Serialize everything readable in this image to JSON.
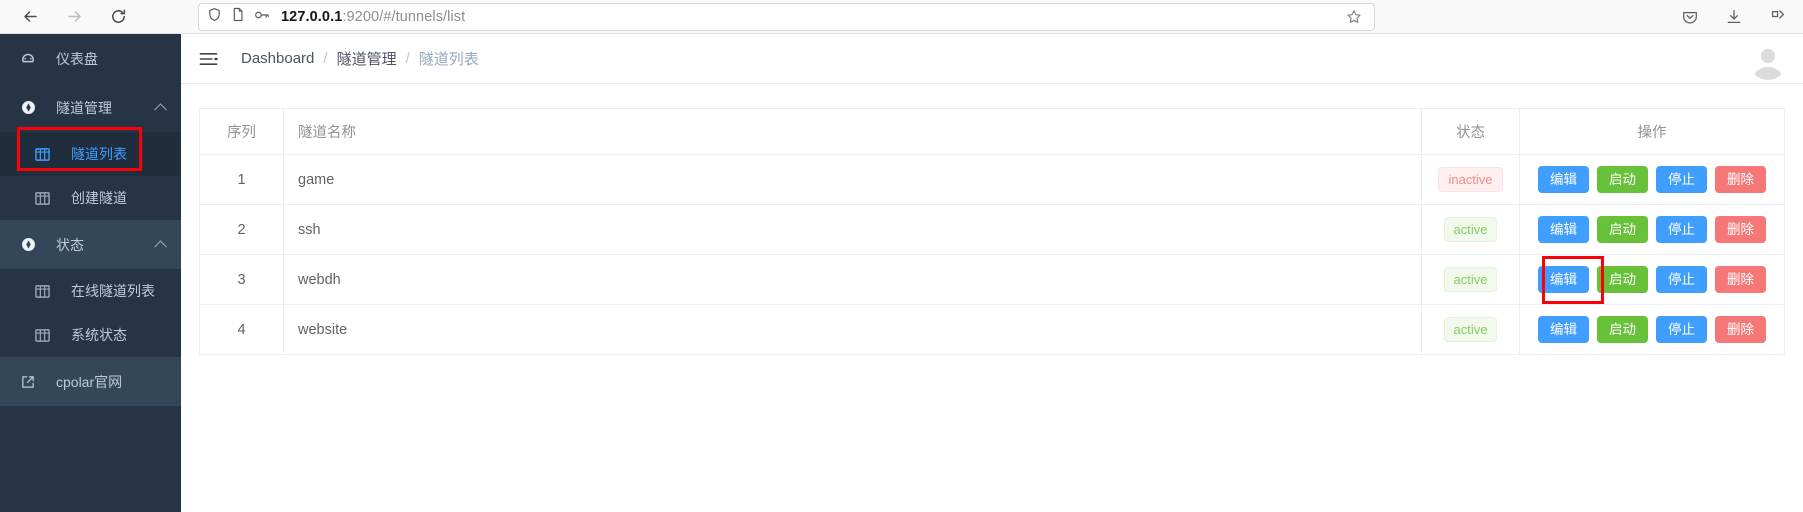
{
  "browser": {
    "nav": {
      "back": "back-arrow",
      "forward": "forward-arrow",
      "reload": "reload"
    },
    "url": {
      "host": "127.0.0.1",
      "rest": ":9200/#/tunnels/list",
      "shield_icon": "shield-icon",
      "page_icon": "page-icon",
      "key_icon": "key-icon",
      "star_icon": "star-icon"
    },
    "toolbar_icons": [
      "pocket-icon",
      "download-icon",
      "extensions-icon"
    ]
  },
  "sidebar": {
    "items": [
      {
        "label": "仪表盘",
        "icon": "gauge-icon",
        "type": "group"
      },
      {
        "label": "隧道管理",
        "icon": "compass-icon",
        "type": "group",
        "expanded": true
      },
      {
        "label": "隧道列表",
        "icon": "grid-icon",
        "type": "sub",
        "active": true
      },
      {
        "label": "创建隧道",
        "icon": "grid-icon",
        "type": "sub",
        "active": false
      },
      {
        "label": "状态",
        "icon": "compass-icon",
        "type": "group",
        "expanded": true
      },
      {
        "label": "在线隧道列表",
        "icon": "grid-icon",
        "type": "sub",
        "active": false
      },
      {
        "label": "系统状态",
        "icon": "grid-icon",
        "type": "sub",
        "active": false
      },
      {
        "label": "cpolar官网",
        "icon": "external-link-icon",
        "type": "external"
      }
    ]
  },
  "topbar": {
    "menu_toggle_icon": "hamburger-icon",
    "breadcrumb": [
      {
        "label": "Dashboard",
        "muted": false
      },
      {
        "label": "隧道管理",
        "muted": false
      },
      {
        "label": "隧道列表",
        "muted": true
      }
    ],
    "separator": "/",
    "avatar": "user-avatar"
  },
  "table": {
    "headers": {
      "seq": "序列",
      "name": "隧道名称",
      "status": "状态",
      "ops": "操作"
    },
    "buttons": {
      "edit": "编辑",
      "start": "启动",
      "stop": "停止",
      "delete": "删除"
    },
    "rows": [
      {
        "seq": "1",
        "name": "game",
        "status": "inactive",
        "status_type": "inactive",
        "highlight_edit": false
      },
      {
        "seq": "2",
        "name": "ssh",
        "status": "active",
        "status_type": "active",
        "highlight_edit": false
      },
      {
        "seq": "3",
        "name": "webdh",
        "status": "active",
        "status_type": "active",
        "highlight_edit": true
      },
      {
        "seq": "4",
        "name": "website",
        "status": "active",
        "status_type": "active",
        "highlight_edit": false
      }
    ]
  },
  "colors": {
    "sidebar_bg": "#263445",
    "sidebar_bg_light": "#344659",
    "sidebar_active_bg": "#1f2d3d",
    "accent": "#409eff",
    "success": "#67c23a",
    "danger": "#f57777",
    "annotation": "#fb0007"
  }
}
